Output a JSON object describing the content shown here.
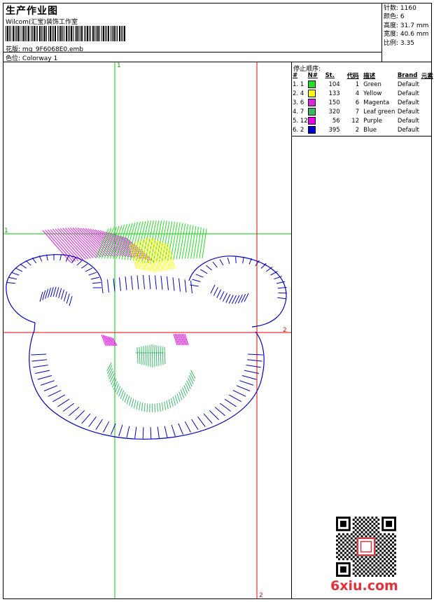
{
  "header": {
    "title": "生产作业图",
    "company": "Wilcom(汇宝)装饰工作室",
    "design_label": "花版:",
    "design_file": "mg_9F6068E0.emb",
    "colorway_label": "色位:",
    "colorway": "Colorway 1"
  },
  "stats": {
    "stitches_label": "针数:",
    "stitches": "1160",
    "colors_label": "颜色:",
    "colors": "6",
    "height_label": "高度:",
    "height": "31.7 mm",
    "width_label": "宽度:",
    "width": "40.6 mm",
    "ratio_label": "比例:",
    "ratio": "3.35"
  },
  "stop_sequence": {
    "title": "停止顺序:",
    "columns": [
      "#",
      "N#",
      "St.",
      "代码",
      "描述",
      "Brand",
      "元素"
    ],
    "rows": [
      {
        "idx": "1.",
        "n": "1",
        "color": "#22dd22",
        "st": "104",
        "code": "1",
        "desc": "Green",
        "brand": "Default"
      },
      {
        "idx": "2.",
        "n": "4",
        "color": "#ffff00",
        "st": "133",
        "code": "4",
        "desc": "Yellow",
        "brand": "Default"
      },
      {
        "idx": "3.",
        "n": "6",
        "color": "#dd22dd",
        "st": "150",
        "code": "6",
        "desc": "Magenta",
        "brand": "Default"
      },
      {
        "idx": "4.",
        "n": "7",
        "color": "#33bb66",
        "st": "320",
        "code": "7",
        "desc": "Leaf green",
        "brand": "Default"
      },
      {
        "idx": "5.",
        "n": "12",
        "color": "#ee00ee",
        "st": "56",
        "code": "12",
        "desc": "Purple",
        "brand": "Default"
      },
      {
        "idx": "6.",
        "n": "2",
        "color": "#0000cc",
        "st": "395",
        "code": "2",
        "desc": "Blue",
        "brand": "Default"
      }
    ]
  },
  "guides": {
    "green_v": "1",
    "green_h": "1",
    "red_h": "2",
    "red_v": "2"
  },
  "colors": {
    "outline": "#0000cc",
    "guide_green": "#00cc00",
    "guide_red": "#ee0000",
    "brand_red": "#e6303a"
  },
  "watermark": {
    "site": "6xiu.com"
  }
}
